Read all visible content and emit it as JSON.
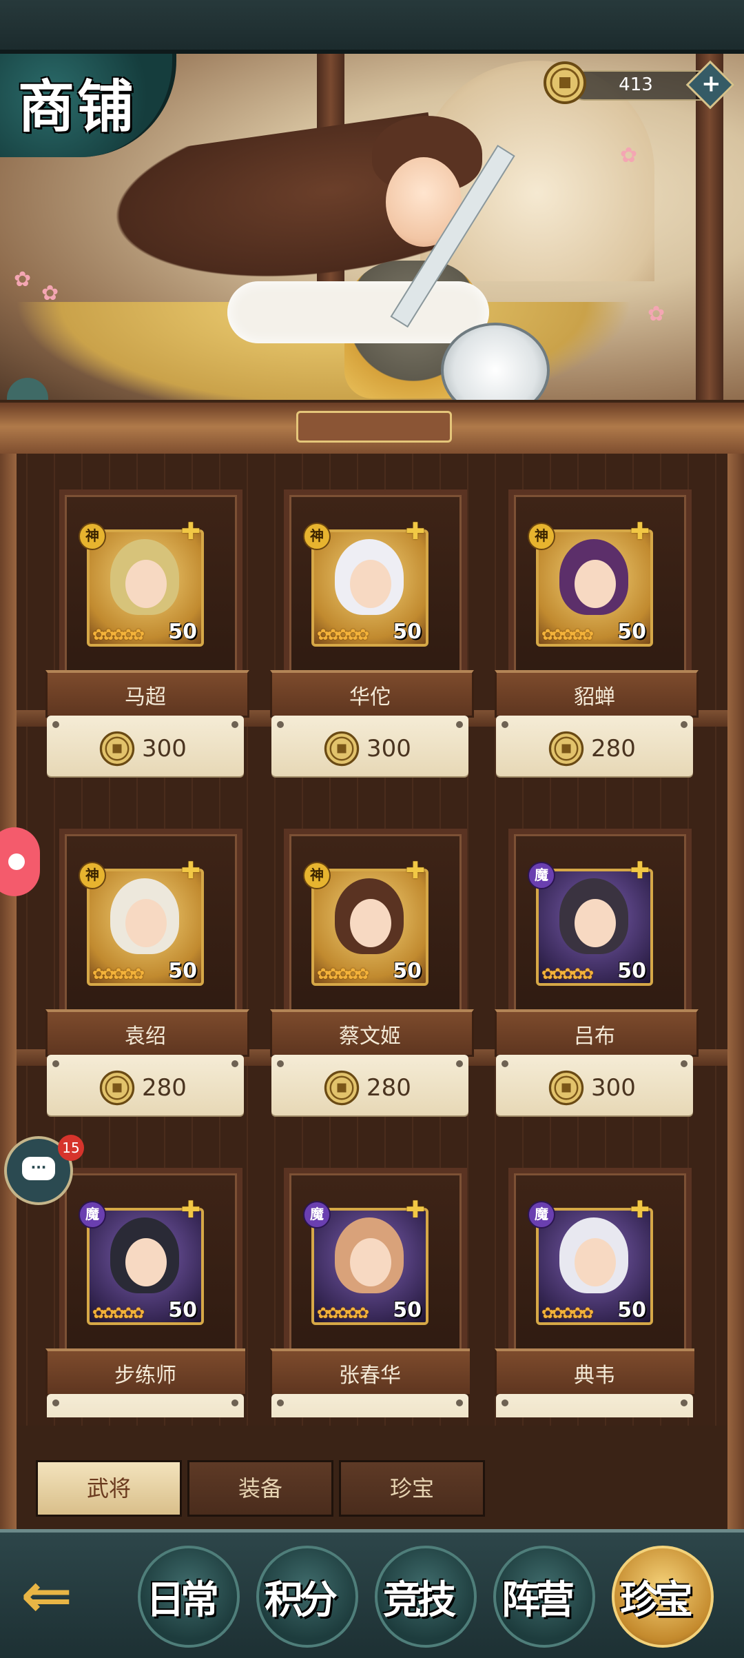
{
  "header": {
    "title": "商铺"
  },
  "currency": {
    "amount": "413",
    "icon": "coin-icon",
    "add_icon": "plus-icon"
  },
  "heroes": [
    {
      "name": "马超",
      "price": "300",
      "badge": "神",
      "level": "50",
      "stars": 5
    },
    {
      "name": "华佗",
      "price": "300",
      "badge": "神",
      "level": "50",
      "stars": 5
    },
    {
      "name": "貂蝉",
      "price": "280",
      "badge": "神",
      "level": "50",
      "stars": 5
    },
    {
      "name": "袁绍",
      "price": "280",
      "badge": "神",
      "level": "50",
      "stars": 5
    },
    {
      "name": "蔡文姬",
      "price": "280",
      "badge": "神",
      "level": "50",
      "stars": 5
    },
    {
      "name": "吕布",
      "price": "300",
      "badge": "魔",
      "level": "50",
      "stars": 5
    },
    {
      "name": "步练师",
      "price": "",
      "badge": "魔",
      "level": "50",
      "stars": 5
    },
    {
      "name": "张春华",
      "price": "",
      "badge": "魔",
      "level": "50",
      "stars": 5
    },
    {
      "name": "典韦",
      "price": "",
      "badge": "魔",
      "level": "50",
      "stars": 5
    }
  ],
  "tabs": [
    {
      "label": "武将",
      "active": true
    },
    {
      "label": "装备",
      "active": false
    },
    {
      "label": "珍宝",
      "active": false
    }
  ],
  "chat": {
    "badge_count": "15"
  },
  "nav": [
    {
      "label": "日常",
      "active": false
    },
    {
      "label": "积分",
      "active": false
    },
    {
      "label": "竞技",
      "active": false
    },
    {
      "label": "阵营",
      "active": false
    },
    {
      "label": "珍宝",
      "active": true
    }
  ],
  "colors": {
    "god_badge": "#e7b42f",
    "demon_badge": "#6a3fb0",
    "active_tab": "#f3e3bd",
    "price_text": "#4a3420"
  }
}
